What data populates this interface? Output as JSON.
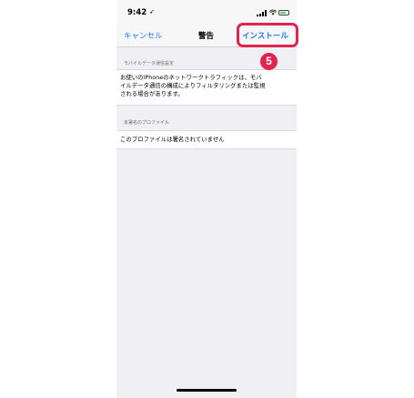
{
  "status_bar": {
    "time": "9:42",
    "location_glyph": "➶"
  },
  "nav": {
    "cancel": "キャンセル",
    "title": "警告",
    "install": "インストール"
  },
  "annotation": {
    "step": "5",
    "color": "#e5224f"
  },
  "sections": [
    {
      "header": "モバイルデータ通信設定",
      "lines": [
        "お使いのiPhoneのネットワークトラフィックは、モバ",
        "イルデータ通信の構成によりフィルタリングまたは監視",
        "される場合があります。"
      ]
    },
    {
      "header": "未署名のプロファイル",
      "lines": [
        "このプロファイルは署名されていません"
      ]
    }
  ],
  "colors": {
    "accent": "#1a7bff",
    "background": "#efeff4"
  }
}
